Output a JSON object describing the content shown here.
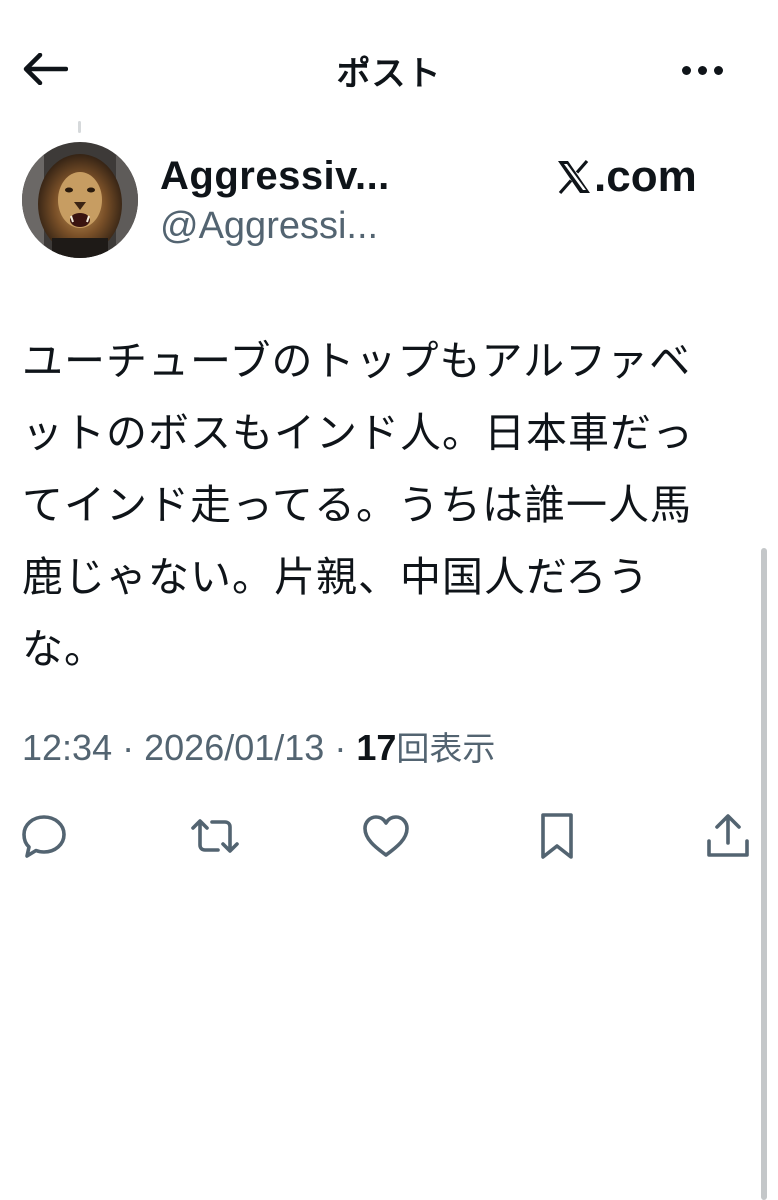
{
  "header": {
    "title": "ポスト",
    "back_icon": "arrow-left-icon",
    "more_icon": "more-horizontal-icon"
  },
  "author": {
    "name": "Aggressiv...",
    "handle": "@Aggressi...",
    "avatar": "lion-avatar-image"
  },
  "brand": {
    "logo_icon": "x-logo-icon",
    "text": ".com"
  },
  "post": {
    "lines": [
      "ユーチューブのトップもアルファベ",
      "ットのボスもインド人。日本車だっ",
      "てインド走ってる。うちは誰一人馬",
      "鹿じゃない。片親、中国人だろう",
      "な。"
    ],
    "time": "12:34",
    "date": "2026/01/13",
    "separator": "·",
    "views_count": "17",
    "views_label": "回表示"
  },
  "actions": [
    {
      "name": "reply-icon"
    },
    {
      "name": "repost-icon"
    },
    {
      "name": "like-icon"
    },
    {
      "name": "bookmark-icon"
    },
    {
      "name": "share-icon"
    }
  ],
  "colors": {
    "text": "#0f1419",
    "secondary": "#536471",
    "background": "#ffffff"
  }
}
